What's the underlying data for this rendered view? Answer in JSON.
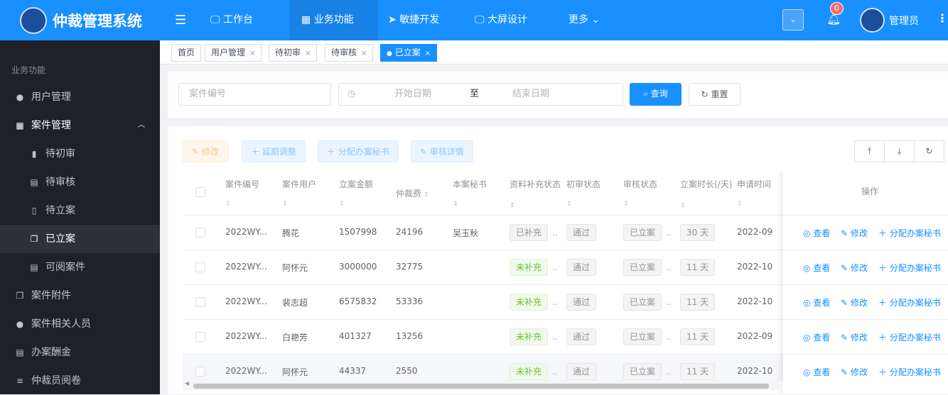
{
  "header": {
    "title": "仲裁管理系统",
    "nav": [
      {
        "label": "工作台",
        "icon": "monitor-icon"
      },
      {
        "label": "业务功能",
        "icon": "grid-icon"
      },
      {
        "label": "敏捷开发",
        "icon": "send-icon"
      },
      {
        "label": "大屏设计",
        "icon": "monitor-icon"
      },
      {
        "label": "更多",
        "icon": "chevron-down-icon"
      }
    ],
    "notifications": "0",
    "user": "管理员",
    "accent": "#1890ff"
  },
  "sidebar": {
    "section": "业务功能",
    "items": [
      {
        "label": "用户管理"
      },
      {
        "label": "案件管理"
      },
      {
        "label": "待初审"
      },
      {
        "label": "待审核"
      },
      {
        "label": "待立案"
      },
      {
        "label": "已立案"
      },
      {
        "label": "可阅案件"
      },
      {
        "label": "案件附件"
      },
      {
        "label": "案件相关人员"
      },
      {
        "label": "办案酬金"
      },
      {
        "label": "仲裁员阅卷"
      }
    ]
  },
  "tabs": [
    {
      "label": "首页"
    },
    {
      "label": "用户管理"
    },
    {
      "label": "待初审"
    },
    {
      "label": "待审核"
    },
    {
      "label": "已立案"
    }
  ],
  "search": {
    "case_no_placeholder": "案件编号",
    "start_placeholder": "开始日期",
    "to": "至",
    "end_placeholder": "结束日期",
    "query": "查询",
    "reset": "重置"
  },
  "toolbar": {
    "edit": "修改",
    "extend": "延期调整",
    "assign": "分配办案秘书",
    "detail": "审核详情"
  },
  "table": {
    "columns": [
      "案件编号",
      "案件用户",
      "立案金额",
      "仲裁费",
      "本案秘书",
      "资料补充状态",
      "初审状态",
      "审核状态",
      "立案时长(/天)",
      "申请时间",
      "操作"
    ],
    "rows": [
      {
        "no": "2022WY...",
        "user": "腾花",
        "amount": "1507998",
        "fee": "24196",
        "secretary": "吴玉秋",
        "supp": "已补充",
        "first": "通过",
        "review": "已立案",
        "days": "30 天",
        "date": "2022-09"
      },
      {
        "no": "2022WY...",
        "user": "阿怀元",
        "amount": "3000000",
        "fee": "32775",
        "secretary": "",
        "supp": "未补充",
        "first": "通过",
        "review": "已立案",
        "days": "11 天",
        "date": "2022-10"
      },
      {
        "no": "2022WY...",
        "user": "裴志超",
        "amount": "6575832",
        "fee": "53336",
        "secretary": "",
        "supp": "未补充",
        "first": "通过",
        "review": "已立案",
        "days": "11 天",
        "date": "2022-10"
      },
      {
        "no": "2022WY...",
        "user": "白艳芳",
        "amount": "401327",
        "fee": "13256",
        "secretary": "",
        "supp": "未补充",
        "first": "通过",
        "review": "已立案",
        "days": "11 天",
        "date": "2022-09"
      },
      {
        "no": "2022WY...",
        "user": "阿怀元",
        "amount": "44337",
        "fee": "2550",
        "secretary": "",
        "supp": "未补充",
        "first": "通过",
        "review": "已立案",
        "days": "11 天",
        "date": "2022-10"
      }
    ],
    "actions": {
      "view": "查看",
      "edit": "修改",
      "assign": "分配办案秘书"
    }
  }
}
